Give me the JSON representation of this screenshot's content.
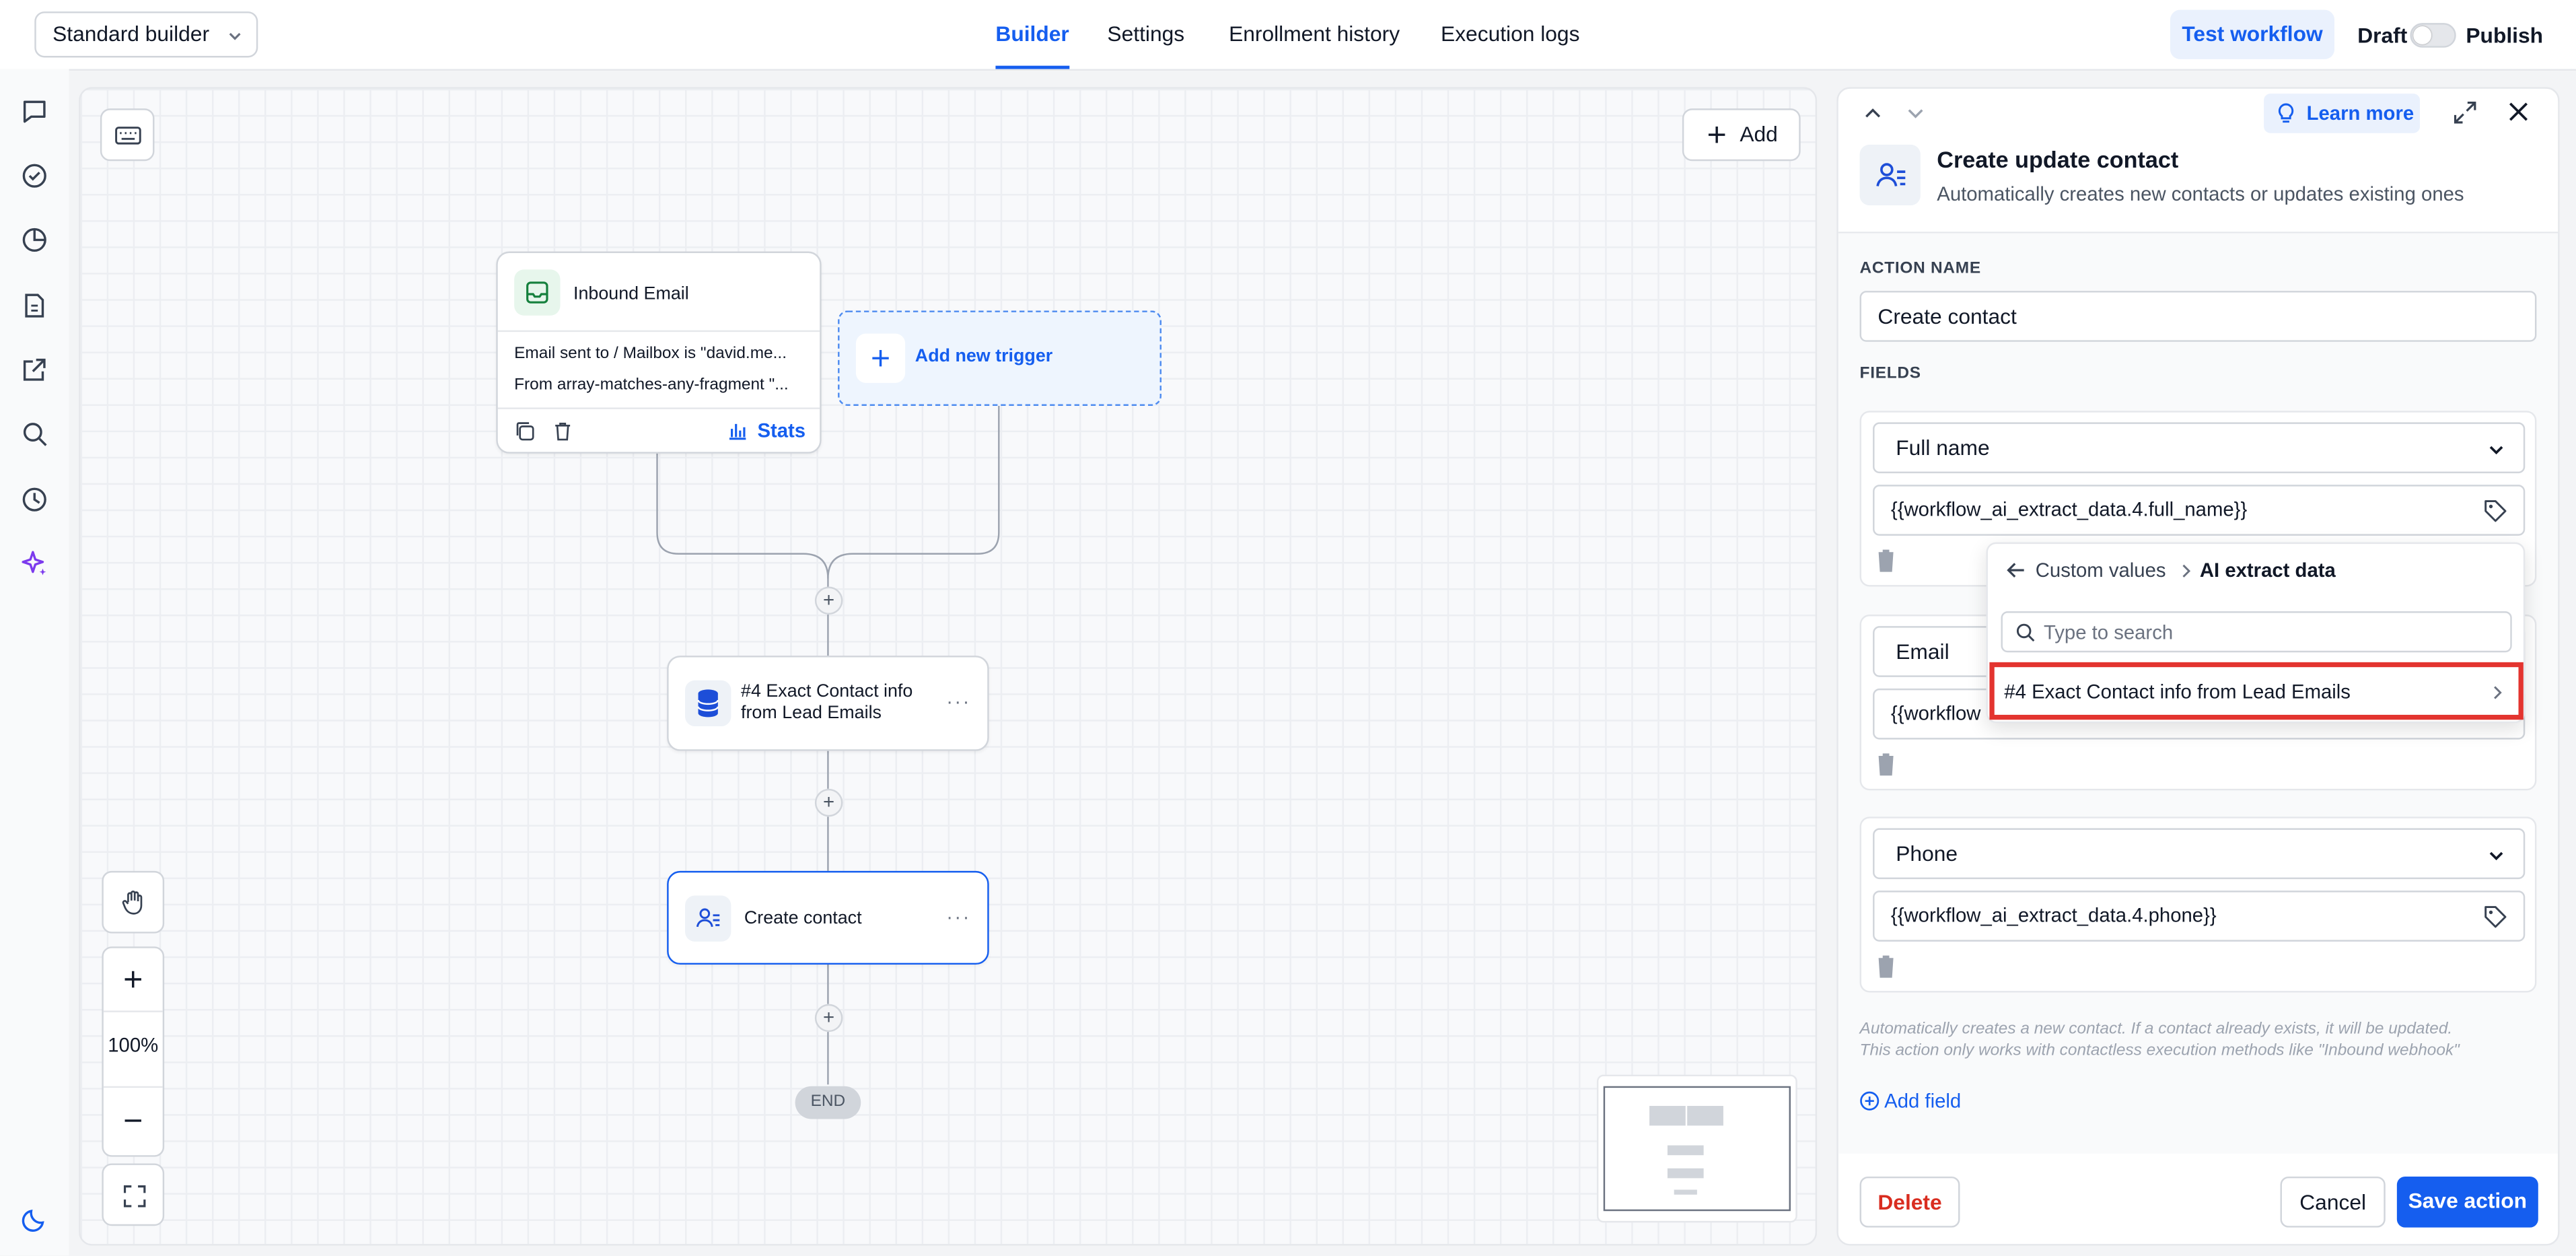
{
  "topbar": {
    "builder_select": "Standard builder",
    "tabs": [
      {
        "label": "Builder",
        "active": true
      },
      {
        "label": "Settings",
        "active": false
      },
      {
        "label": "Enrollment history",
        "active": false
      },
      {
        "label": "Execution logs",
        "active": false
      }
    ],
    "test_workflow": "Test workflow",
    "draft": "Draft",
    "publish": "Publish"
  },
  "canvas": {
    "add_label": "Add",
    "trigger": {
      "title": "Inbound Email",
      "line1": "Email sent to / Mailbox is \"david.me...",
      "line2": "From array-matches-any-fragment \"...",
      "stats": "Stats"
    },
    "add_trigger": "Add new trigger",
    "node_extract": "#4 Exact Contact info from Lead Emails",
    "node_create": "Create contact",
    "end": "END",
    "zoom": "100%"
  },
  "panel": {
    "learn_more": "Learn more",
    "title": "Create update contact",
    "subtitle": "Automatically creates new contacts or updates existing ones",
    "action_name_label": "ACTION NAME",
    "action_name_value": "Create contact",
    "fields_label": "FIELDS",
    "fields": [
      {
        "name": "Full name",
        "value": "{{workflow_ai_extract_data.4.full_name}}"
      },
      {
        "name": "Email",
        "value": "{{workflow"
      },
      {
        "name": "Phone",
        "value": "{{workflow_ai_extract_data.4.phone}}"
      }
    ],
    "note_line1": "Automatically creates a new contact. If a contact already exists, it will be updated.",
    "note_line2": "This action only works with contactless execution methods like \"Inbound webhook\"",
    "add_field": "Add field",
    "delete": "Delete",
    "cancel": "Cancel",
    "save": "Save action"
  },
  "dropdown": {
    "crumb_root": "Custom values",
    "crumb_current": "AI extract data",
    "search_placeholder": "Type to search",
    "item": "#4 Exact Contact info from Lead Emails"
  },
  "colors": {
    "accent": "#155eef",
    "danger": "#d92d20",
    "highlight": "#e3342f"
  }
}
